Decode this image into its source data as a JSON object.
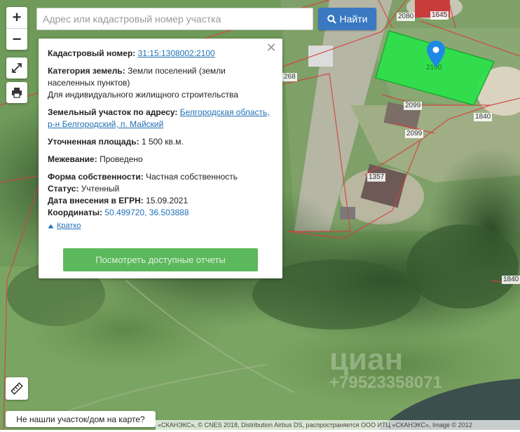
{
  "search": {
    "placeholder": "Адрес или кадастровый номер участка",
    "button_label": "Найти"
  },
  "zoom": {
    "in_label": "+",
    "out_label": "−"
  },
  "map": {
    "parcel_labels": [
      "2080",
      "1645",
      "268",
      "2100",
      "2099",
      "2099",
      "1840",
      "1357",
      "1840"
    ],
    "colors": {
      "selected_parcel": "#2de04a",
      "boundary": "#d44040",
      "marker": "#1e88e5"
    }
  },
  "info": {
    "cadastral": {
      "label": "Кадастровый номер:",
      "value": "31:15:1308002:2100"
    },
    "category": {
      "label": "Категория земель:",
      "value": "Земли поселений (земли населенных пунктов)",
      "use": "Для индивидуального жилищного строительства"
    },
    "address": {
      "label": "Земельный участок по адресу:",
      "value": "Белгородская область, р-н Белгородский, п. Майский"
    },
    "area": {
      "label": "Уточненная площадь:",
      "value": "1 500 кв.м."
    },
    "survey": {
      "label": "Межевание:",
      "value": "Проведено"
    },
    "ownership": {
      "label": "Форма собственности:",
      "value": "Частная собственность"
    },
    "status": {
      "label": "Статус:",
      "value": "Учтенный"
    },
    "egrn_date": {
      "label": "Дата внесения в ЕГРН:",
      "value": "15.09.2021"
    },
    "coords": {
      "label": "Координаты:",
      "value": "50.499720, 36.503888"
    },
    "brief_label": "Кратко",
    "report_button": "Посмотреть доступные отчеты"
  },
  "not_found": "Не нашли участок/дом на карте?",
  "attribution": "«СКАНЭКС», © CNES 2018, Distribution Airbus DS, распространяется ООО ИТЦ «СКАНЭКС», Image © 2012",
  "watermark": {
    "brand": "циан",
    "phone": "+79523358071"
  }
}
